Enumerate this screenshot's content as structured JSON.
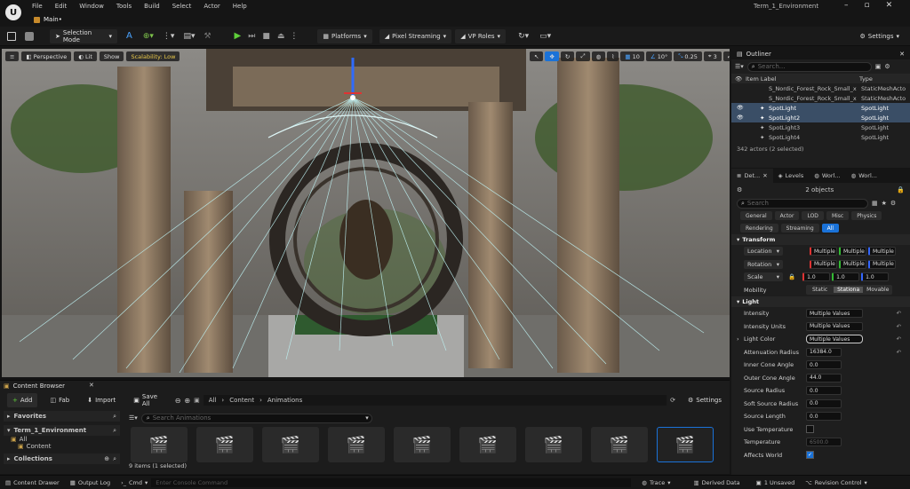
{
  "window": {
    "title": "Term_1_Environment",
    "tab": "Main•"
  },
  "menu": [
    "File",
    "Edit",
    "Window",
    "Tools",
    "Build",
    "Select",
    "Actor",
    "Help"
  ],
  "toolbar": {
    "mode": "Selection Mode",
    "platforms": "Platforms",
    "pixel_streaming": "Pixel Streaming",
    "vp_roles": "VP Roles",
    "settings": "Settings"
  },
  "viewport": {
    "perspective": "Perspective",
    "lit": "Lit",
    "show": "Show",
    "scalability": "Scalability: Low",
    "grid": "10",
    "angle": "10°",
    "scale": "0.25",
    "speed": "3"
  },
  "outliner": {
    "title": "Outliner",
    "search_placeholder": "Search...",
    "col_label": "Item Label",
    "col_type": "Type",
    "rows": [
      {
        "label": "S_Nordic_Forest_Rock_Small_x",
        "type": "StaticMeshActo",
        "sel": false
      },
      {
        "label": "S_Nordic_Forest_Rock_Small_x",
        "type": "StaticMeshActo",
        "sel": false
      },
      {
        "label": "SpotLight",
        "type": "SpotLight",
        "sel": true
      },
      {
        "label": "SpotLight2",
        "type": "SpotLight",
        "sel": true
      },
      {
        "label": "SpotLight3",
        "type": "SpotLight",
        "sel": false
      },
      {
        "label": "SpotLight4",
        "type": "SpotLight",
        "sel": false
      }
    ],
    "count": "342 actors (2 selected)"
  },
  "details": {
    "tabs": [
      "Det...",
      "Levels",
      "Worl...",
      "Worl..."
    ],
    "objects": "2 objects",
    "search_placeholder": "Search",
    "filters1": [
      "General",
      "Actor",
      "LOD",
      "Misc",
      "Physics"
    ],
    "filters2": [
      "Rendering",
      "Streaming",
      "All"
    ],
    "transform": {
      "title": "Transform",
      "location": "Location",
      "rotation": "Rotation",
      "scale": "Scale",
      "multiple": "Multiple",
      "scale_val": "1.0",
      "mobility": "Mobility",
      "mob_opts": [
        "Static",
        "Stationa",
        "Movable"
      ]
    },
    "light": {
      "title": "Light",
      "props": [
        {
          "label": "Intensity",
          "value": "Multiple Values"
        },
        {
          "label": "Intensity Units",
          "value": "Multiple Values"
        },
        {
          "label": "Light Color",
          "value": "Multiple Values"
        },
        {
          "label": "Attenuation Radius",
          "value": "16384.0"
        },
        {
          "label": "Inner Cone Angle",
          "value": "0.0"
        },
        {
          "label": "Outer Cone Angle",
          "value": "44.0"
        },
        {
          "label": "Source Radius",
          "value": "0.0"
        },
        {
          "label": "Soft Source Radius",
          "value": "0.0"
        },
        {
          "label": "Source Length",
          "value": "0.0"
        },
        {
          "label": "Use Temperature",
          "value": ""
        },
        {
          "label": "Temperature",
          "value": "6500.0"
        },
        {
          "label": "Affects World",
          "value": ""
        }
      ]
    }
  },
  "content_browser": {
    "tab": "Content Browser",
    "add": "Add",
    "fab": "Fab",
    "import": "Import",
    "save_all": "Save All",
    "path": [
      "All",
      "Content",
      "Animations"
    ],
    "settings": "Settings",
    "favorites": "Favorites",
    "project": "Term_1_Environment",
    "tree": [
      "All",
      "Content"
    ],
    "collections": "Collections",
    "search_placeholder": "Search Animations",
    "count": "9 items (1 selected)",
    "asset_count": 9
  },
  "status": {
    "content_drawer": "Content Drawer",
    "output_log": "Output Log",
    "cmd": "Cmd",
    "console_placeholder": "Enter Console Command",
    "trace": "Trace",
    "derived_data": "Derived Data",
    "unsaved": "1 Unsaved",
    "revision": "Revision Control"
  }
}
